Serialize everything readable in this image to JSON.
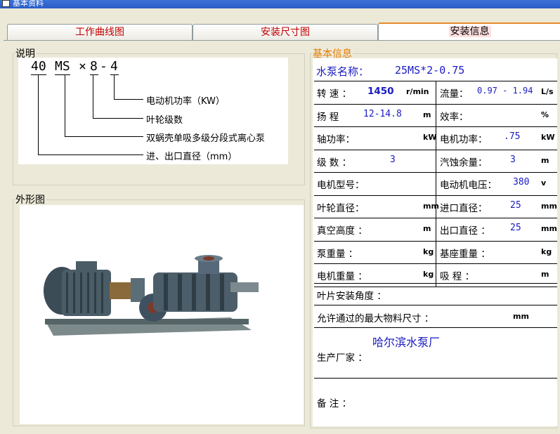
{
  "window": {
    "title": "基本资料"
  },
  "tabs": [
    {
      "label": "工作曲线图"
    },
    {
      "label": "安装尺寸图"
    },
    {
      "label": "安装信息"
    }
  ],
  "explain": {
    "legend": "说明",
    "code": [
      "40",
      "MS",
      "×",
      "8",
      "-",
      "4"
    ],
    "labels": [
      "电动机功率（KW）",
      "叶轮级数",
      "双蜗壳单吸多级分段式离心泵",
      "进、出口直径（mm）"
    ]
  },
  "appearance": {
    "legend": "外形图",
    "image_alt": "pump photo"
  },
  "basic": {
    "legend": "基本信息",
    "pump_name_label": "水泵名称：",
    "pump_name_value": "25MS*2-0.75",
    "rows": [
      {
        "l_label": "转 速 ：",
        "l_value": "1450",
        "l_unit": "r/min",
        "r_label": "流量：",
        "r_value": "0.97 - 1.94",
        "r_unit": "L/s"
      },
      {
        "l_label": "扬 程",
        "l_value": "12-14.8",
        "l_unit": "m",
        "r_label": "效率：",
        "r_value": "",
        "r_unit": "%"
      },
      {
        "l_label": "轴功率：",
        "l_value": "",
        "l_unit": "kW",
        "r_label": "电机功率：",
        "r_value": ".75",
        "r_unit": "kW"
      },
      {
        "l_label": "级 数 ：",
        "l_value": "3",
        "l_unit": "",
        "r_label": "汽蚀余量：",
        "r_value": "3",
        "r_unit": "m"
      },
      {
        "l_label": "电机型号：",
        "l_value": "",
        "l_unit": "",
        "r_label": "电动机电压：",
        "r_value": "380",
        "r_unit": "v"
      },
      {
        "l_label": "叶轮直径：",
        "l_value": "",
        "l_unit": "mm",
        "r_label": "进口直径：",
        "r_value": "25",
        "r_unit": "mm"
      },
      {
        "l_label": "真空高度 ：",
        "l_value": "",
        "l_unit": "m",
        "r_label": "出口直径 ：",
        "r_value": "25",
        "r_unit": "mm"
      },
      {
        "l_label": "泵重量 ：",
        "l_value": "",
        "l_unit": "kg",
        "r_label": "基座重量 ：",
        "r_value": "",
        "r_unit": "kg"
      },
      {
        "l_label": "电机重量 ：",
        "l_value": "",
        "l_unit": "kg",
        "r_label": "吸 程 ：",
        "r_value": "",
        "r_unit": "m"
      }
    ],
    "blade_angle_label": "叶片安装角度 ：",
    "max_particle_label": "允许通过的最大物料尺寸 ：",
    "max_particle_unit": "mm",
    "manufacturer_value": "哈尔滨水泵厂",
    "manufacturer_label": "生产厂家 ：",
    "remark_label": "备  注 ："
  }
}
